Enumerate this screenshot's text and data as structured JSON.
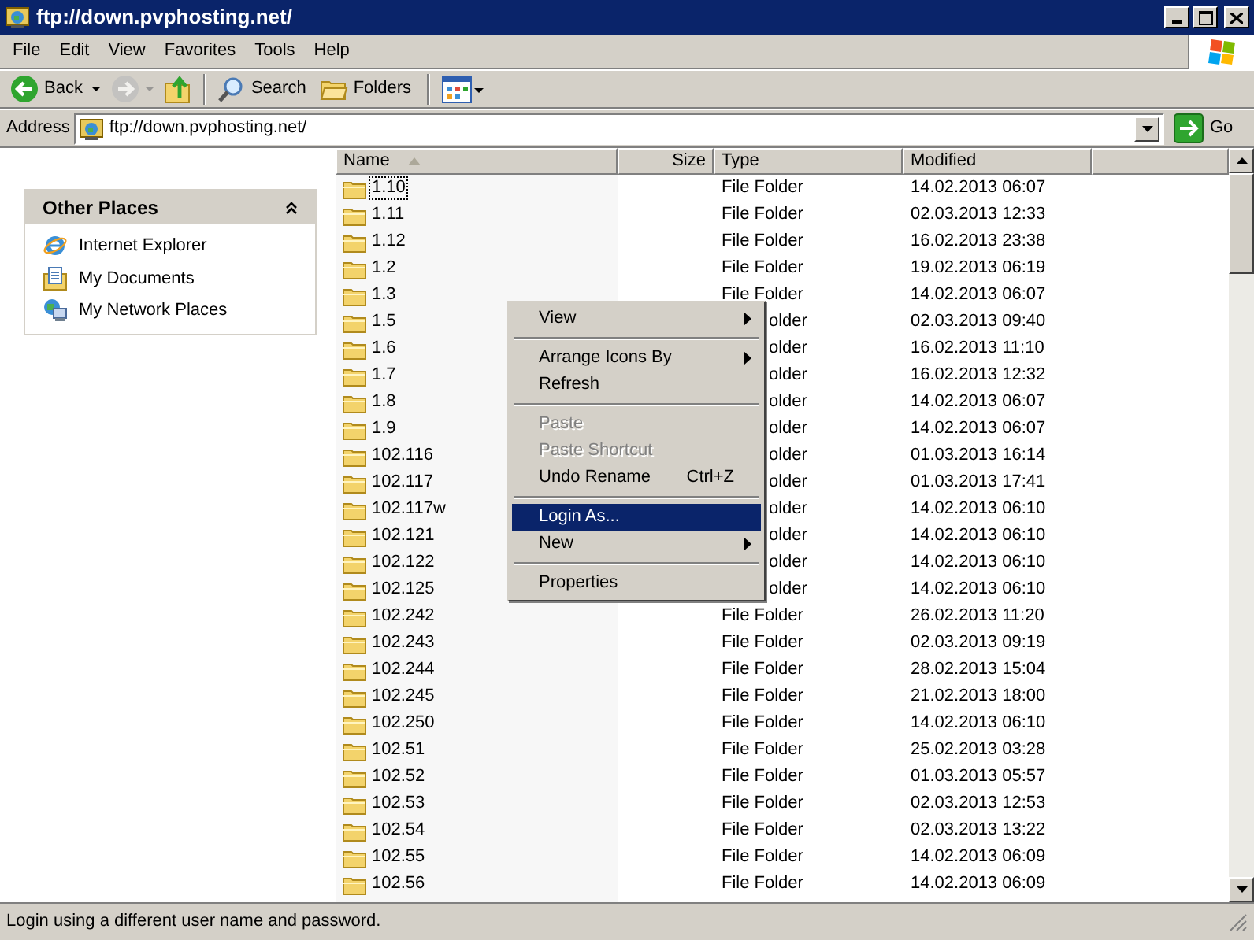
{
  "window": {
    "title": "ftp://down.pvphosting.net/"
  },
  "menu_bar": [
    "File",
    "Edit",
    "View",
    "Favorites",
    "Tools",
    "Help"
  ],
  "toolbar": [
    {
      "kind": "back",
      "label": "Back",
      "disabled": false
    },
    {
      "kind": "forward",
      "disabled": true
    },
    {
      "kind": "up",
      "disabled": false
    },
    {
      "kind": "search",
      "label": "Search",
      "disabled": false
    },
    {
      "kind": "folders",
      "label": "Folders",
      "disabled": false
    },
    {
      "kind": "views",
      "disabled": false
    }
  ],
  "address_bar": {
    "label": "Address",
    "value": "ftp://down.pvphosting.net/",
    "go": "Go"
  },
  "other_places": {
    "title": "Other Places",
    "expanded": true,
    "items": [
      {
        "kind": "ie",
        "label": "Internet Explorer"
      },
      {
        "kind": "documents",
        "label": "My Documents"
      },
      {
        "kind": "network",
        "label": "My Network Places"
      }
    ]
  },
  "table": {
    "columns": [
      "Name",
      "Size",
      "Type",
      "Modified"
    ],
    "rows": [
      {
        "name": "1.10",
        "type": "File Folder",
        "modified": "14.02.2013 06:07",
        "focused": true,
        "covered": false
      },
      {
        "name": "1.11",
        "type": "File Folder",
        "modified": "02.03.2013 12:33",
        "focused": false,
        "covered": false
      },
      {
        "name": "1.12",
        "type": "File Folder",
        "modified": "16.02.2013 23:38",
        "focused": false,
        "covered": false
      },
      {
        "name": "1.2",
        "type": "File Folder",
        "modified": "19.02.2013 06:19",
        "focused": false,
        "covered": false
      },
      {
        "name": "1.3",
        "type": "File Folder",
        "modified": "14.02.2013 06:07",
        "focused": false,
        "covered": false
      },
      {
        "name": "1.5",
        "type": "older",
        "modified": "02.03.2013 09:40",
        "focused": false,
        "covered": true
      },
      {
        "name": "1.6",
        "type": "older",
        "modified": "16.02.2013 11:10",
        "focused": false,
        "covered": true
      },
      {
        "name": "1.7",
        "type": "older",
        "modified": "16.02.2013 12:32",
        "focused": false,
        "covered": true
      },
      {
        "name": "1.8",
        "type": "older",
        "modified": "14.02.2013 06:07",
        "focused": false,
        "covered": true
      },
      {
        "name": "1.9",
        "type": "older",
        "modified": "14.02.2013 06:07",
        "focused": false,
        "covered": true
      },
      {
        "name": "102.116",
        "type": "older",
        "modified": "01.03.2013 16:14",
        "focused": false,
        "covered": true
      },
      {
        "name": "102.117",
        "type": "older",
        "modified": "01.03.2013 17:41",
        "focused": false,
        "covered": true
      },
      {
        "name": "102.117w",
        "type": "older",
        "modified": "14.02.2013 06:10",
        "focused": false,
        "covered": true
      },
      {
        "name": "102.121",
        "type": "older",
        "modified": "14.02.2013 06:10",
        "focused": false,
        "covered": true
      },
      {
        "name": "102.122",
        "type": "older",
        "modified": "14.02.2013 06:10",
        "focused": false,
        "covered": true
      },
      {
        "name": "102.125",
        "type": "older",
        "modified": "14.02.2013 06:10",
        "focused": false,
        "covered": true
      },
      {
        "name": "102.242",
        "type": "File Folder",
        "modified": "26.02.2013 11:20",
        "focused": false,
        "covered": false
      },
      {
        "name": "102.243",
        "type": "File Folder",
        "modified": "02.03.2013 09:19",
        "focused": false,
        "covered": false
      },
      {
        "name": "102.244",
        "type": "File Folder",
        "modified": "28.02.2013 15:04",
        "focused": false,
        "covered": false
      },
      {
        "name": "102.245",
        "type": "File Folder",
        "modified": "21.02.2013 18:00",
        "focused": false,
        "covered": false
      },
      {
        "name": "102.250",
        "type": "File Folder",
        "modified": "14.02.2013 06:10",
        "focused": false,
        "covered": false
      },
      {
        "name": "102.51",
        "type": "File Folder",
        "modified": "25.02.2013 03:28",
        "focused": false,
        "covered": false
      },
      {
        "name": "102.52",
        "type": "File Folder",
        "modified": "01.03.2013 05:57",
        "focused": false,
        "covered": false
      },
      {
        "name": "102.53",
        "type": "File Folder",
        "modified": "02.03.2013 12:53",
        "focused": false,
        "covered": false
      },
      {
        "name": "102.54",
        "type": "File Folder",
        "modified": "02.03.2013 13:22",
        "focused": false,
        "covered": false
      },
      {
        "name": "102.55",
        "type": "File Folder",
        "modified": "14.02.2013 06:09",
        "focused": false,
        "covered": false
      },
      {
        "name": "102.56",
        "type": "File Folder",
        "modified": "14.02.2013 06:09",
        "focused": false,
        "covered": false
      }
    ]
  },
  "context_menu": [
    {
      "kind": "item",
      "label": "View",
      "submenu": true,
      "disabled": false,
      "selected": false
    },
    {
      "kind": "separator"
    },
    {
      "kind": "item",
      "label": "Arrange Icons By",
      "submenu": true,
      "disabled": false,
      "selected": false
    },
    {
      "kind": "item",
      "label": "Refresh",
      "submenu": false,
      "disabled": false,
      "selected": false
    },
    {
      "kind": "separator"
    },
    {
      "kind": "item",
      "label": "Paste",
      "submenu": false,
      "disabled": true,
      "selected": false
    },
    {
      "kind": "item",
      "label": "Paste Shortcut",
      "submenu": false,
      "disabled": true,
      "selected": false
    },
    {
      "kind": "item",
      "label": "Undo Rename",
      "shortcut": "Ctrl+Z",
      "submenu": false,
      "disabled": false,
      "selected": false
    },
    {
      "kind": "separator"
    },
    {
      "kind": "item",
      "label": "Login As...",
      "submenu": false,
      "disabled": false,
      "selected": true
    },
    {
      "kind": "item",
      "label": "New",
      "submenu": true,
      "disabled": false,
      "selected": false
    },
    {
      "kind": "separator"
    },
    {
      "kind": "item",
      "label": "Properties",
      "submenu": false,
      "disabled": false,
      "selected": false
    }
  ],
  "status_bar": "Login using a different user name and password."
}
